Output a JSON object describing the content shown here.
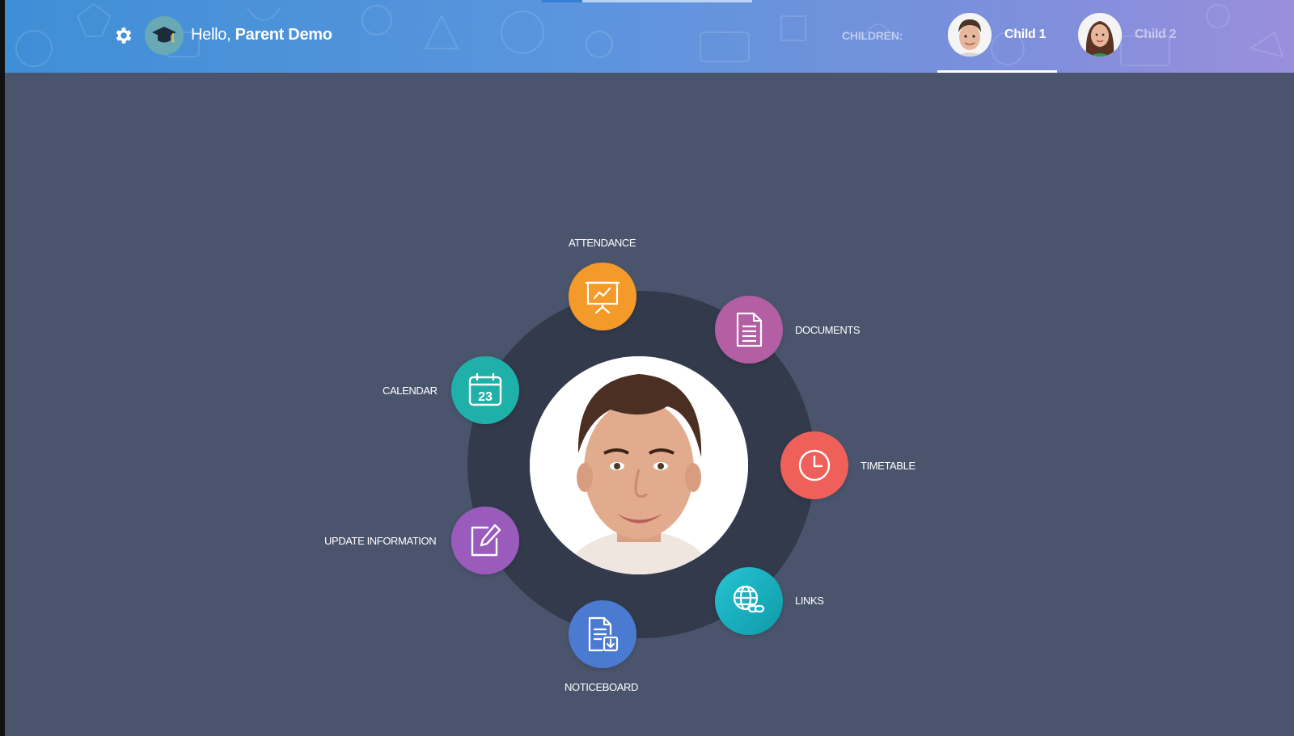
{
  "header": {
    "greeting_prefix": "Hello, ",
    "user_name": "Parent Demo",
    "children_label": "CHILDREN:",
    "children": [
      {
        "name": "Child 1",
        "active": true
      },
      {
        "name": "Child 2",
        "active": false
      }
    ]
  },
  "menu": {
    "attendance": "ATTENDANCE",
    "documents": "DOCUMENTS",
    "calendar": "CALENDAR",
    "calendar_day": "23",
    "timetable": "TIMETABLE",
    "update_information": "UPDATE INFORMATION",
    "links": "LINKS",
    "noticeboard": "NOTICEBOARD"
  },
  "colors": {
    "header_start": "#3f8fd6",
    "header_end": "#9a8fdc",
    "background": "#4a556d",
    "ring": "#323a4c",
    "attendance": "#f39a2b",
    "documents": "#b45ea4",
    "calendar": "#1fb1a9",
    "timetable": "#f0605a",
    "update_information": "#9a5bbd",
    "links": "#17b8c6",
    "noticeboard": "#4b7bd1"
  }
}
